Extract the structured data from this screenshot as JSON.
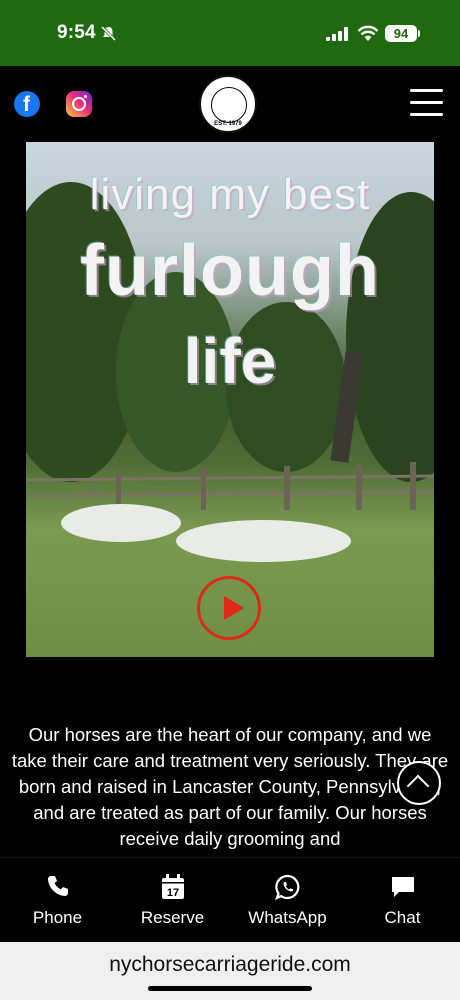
{
  "status_bar": {
    "time": "9:54",
    "battery": "94"
  },
  "header": {
    "logo_text": "EST. 1979",
    "social": [
      "facebook-icon",
      "instagram-icon"
    ],
    "menu_icon": "hamburger-menu-icon"
  },
  "video": {
    "caption_line1": "living my best",
    "caption_line2": "furlough",
    "caption_line3": "life",
    "play_icon": "play-icon"
  },
  "body": {
    "text": "Our horses are the heart of our company, and we take their care and treatment very seriously. They are born and raised in Lancaster County, Pennsylvania, and are treated as part of our family. Our horses receive daily grooming and"
  },
  "bottom_nav": {
    "items": [
      {
        "label": "Phone",
        "icon": "phone-icon"
      },
      {
        "label": "Reserve",
        "icon": "calendar-icon",
        "badge": "17"
      },
      {
        "label": "WhatsApp",
        "icon": "whatsapp-icon"
      },
      {
        "label": "Chat",
        "icon": "chat-icon"
      }
    ]
  },
  "url_bar": {
    "url": "nychorsecarriageride.com"
  },
  "colors": {
    "status_green": "#1f6a10",
    "play_red": "#e02818",
    "facebook_blue": "#1877f2"
  }
}
